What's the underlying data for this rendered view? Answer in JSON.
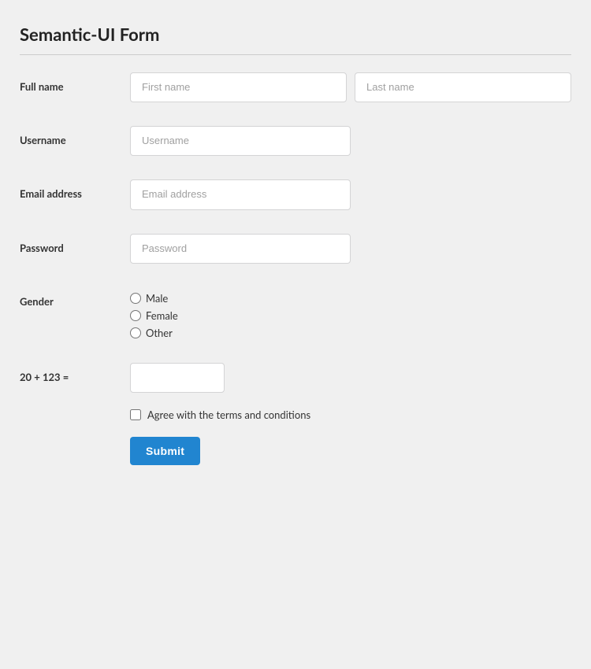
{
  "page": {
    "title": "Semantic-UI Form"
  },
  "form": {
    "fields": {
      "fullname": {
        "label": "Full name",
        "first_placeholder": "First name",
        "last_placeholder": "Last name"
      },
      "username": {
        "label": "Username",
        "placeholder": "Username"
      },
      "email": {
        "label": "Email address",
        "placeholder": "Email address"
      },
      "password": {
        "label": "Password",
        "placeholder": "Password"
      },
      "gender": {
        "label": "Gender",
        "options": [
          "Male",
          "Female",
          "Other"
        ]
      },
      "captcha": {
        "label": "20 + 123 =",
        "placeholder": ""
      },
      "terms": {
        "label": "Agree with the terms and conditions"
      }
    },
    "submit_label": "Submit"
  }
}
